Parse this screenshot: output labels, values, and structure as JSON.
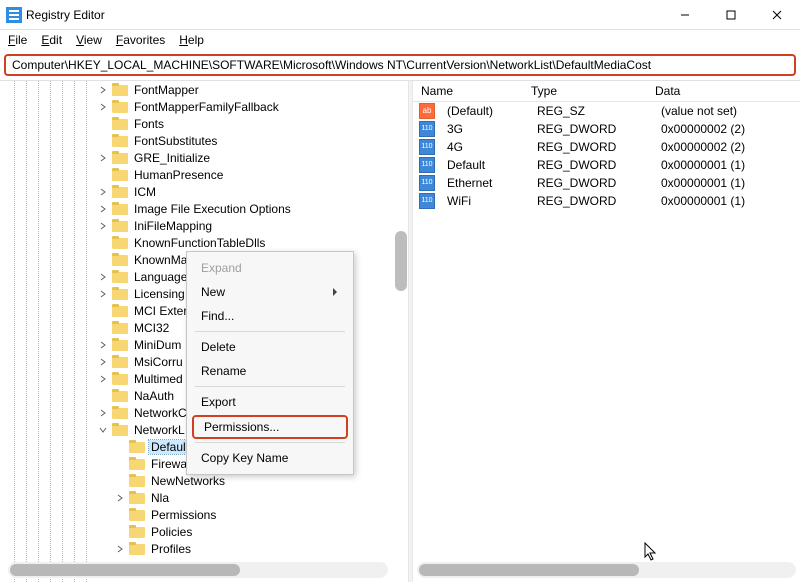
{
  "window": {
    "title": "Registry Editor"
  },
  "menu": {
    "file": "File",
    "edit": "Edit",
    "view": "View",
    "favorites": "Favorites",
    "help": "Help"
  },
  "address": {
    "path": "Computer\\HKEY_LOCAL_MACHINE\\SOFTWARE\\Microsoft\\Windows NT\\CurrentVersion\\NetworkList\\DefaultMediaCost"
  },
  "tree": {
    "items": [
      {
        "label": "FontMapper",
        "twisty": "closed",
        "depth": 0
      },
      {
        "label": "FontMapperFamilyFallback",
        "twisty": "closed",
        "depth": 0
      },
      {
        "label": "Fonts",
        "twisty": "none",
        "depth": 0
      },
      {
        "label": "FontSubstitutes",
        "twisty": "none",
        "depth": 0
      },
      {
        "label": "GRE_Initialize",
        "twisty": "closed",
        "depth": 0
      },
      {
        "label": "HumanPresence",
        "twisty": "none",
        "depth": 0
      },
      {
        "label": "ICM",
        "twisty": "closed",
        "depth": 0
      },
      {
        "label": "Image File Execution Options",
        "twisty": "closed",
        "depth": 0
      },
      {
        "label": "IniFileMapping",
        "twisty": "closed",
        "depth": 0
      },
      {
        "label": "KnownFunctionTableDlls",
        "twisty": "none",
        "depth": 0
      },
      {
        "label": "KnownMa",
        "twisty": "none",
        "depth": 0
      },
      {
        "label": "Language",
        "twisty": "closed",
        "depth": 0
      },
      {
        "label": "Licensing",
        "twisty": "closed",
        "depth": 0
      },
      {
        "label": "MCI Exter",
        "twisty": "none",
        "depth": 0
      },
      {
        "label": "MCI32",
        "twisty": "none",
        "depth": 0
      },
      {
        "label": "MiniDum",
        "twisty": "closed",
        "depth": 0
      },
      {
        "label": "MsiCorru",
        "twisty": "closed",
        "depth": 0
      },
      {
        "label": "Multimed",
        "twisty": "closed",
        "depth": 0
      },
      {
        "label": "NaAuth",
        "twisty": "none",
        "depth": 0
      },
      {
        "label": "NetworkC",
        "twisty": "closed",
        "depth": 0
      },
      {
        "label": "NetworkL",
        "twisty": "open",
        "depth": 0
      },
      {
        "label": "DefaultMediaCost",
        "twisty": "none",
        "depth": 1,
        "selected": true
      },
      {
        "label": "FirewallSync",
        "twisty": "none",
        "depth": 1
      },
      {
        "label": "NewNetworks",
        "twisty": "none",
        "depth": 1
      },
      {
        "label": "Nla",
        "twisty": "closed",
        "depth": 1
      },
      {
        "label": "Permissions",
        "twisty": "none",
        "depth": 1
      },
      {
        "label": "Policies",
        "twisty": "none",
        "depth": 1
      },
      {
        "label": "Profiles",
        "twisty": "closed",
        "depth": 1
      }
    ]
  },
  "context_menu": {
    "expand": "Expand",
    "new": "New",
    "find": "Find...",
    "delete": "Delete",
    "rename": "Rename",
    "export": "Export",
    "permissions": "Permissions...",
    "copy_key_name": "Copy Key Name"
  },
  "list": {
    "columns": {
      "name": "Name",
      "type": "Type",
      "data": "Data"
    },
    "rows": [
      {
        "icon": "str",
        "name": "(Default)",
        "type": "REG_SZ",
        "data": "(value not set)"
      },
      {
        "icon": "bin",
        "name": "3G",
        "type": "REG_DWORD",
        "data": "0x00000002 (2)"
      },
      {
        "icon": "bin",
        "name": "4G",
        "type": "REG_DWORD",
        "data": "0x00000002 (2)"
      },
      {
        "icon": "bin",
        "name": "Default",
        "type": "REG_DWORD",
        "data": "0x00000001 (1)"
      },
      {
        "icon": "bin",
        "name": "Ethernet",
        "type": "REG_DWORD",
        "data": "0x00000001 (1)"
      },
      {
        "icon": "bin",
        "name": "WiFi",
        "type": "REG_DWORD",
        "data": "0x00000001 (1)"
      }
    ]
  }
}
